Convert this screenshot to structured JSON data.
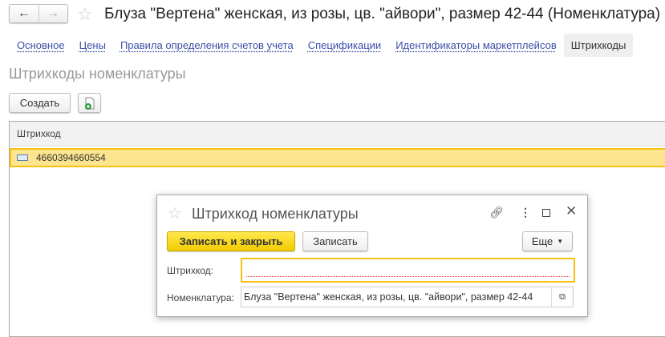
{
  "window": {
    "title": "Блуза \"Вертена\" женская, из розы, цв. \"айвори\", размер 42-44 (Номенклатура)",
    "back": "←",
    "forward": "→"
  },
  "tabs": [
    {
      "label": "Основное"
    },
    {
      "label": "Цены"
    },
    {
      "label": "Правила определения счетов учета"
    },
    {
      "label": "Спецификации"
    },
    {
      "label": "Идентификаторы маркетплейсов"
    },
    {
      "label": "Штрихкоды"
    }
  ],
  "section": {
    "title": "Штрихкоды номенклатуры",
    "create_label": "Создать"
  },
  "grid": {
    "column": "Штрихкод",
    "rows": [
      {
        "barcode": "4660394660554"
      }
    ]
  },
  "dialog": {
    "title": "Штрихкод номенклатуры",
    "save_close": "Записать и закрыть",
    "save": "Записать",
    "more": "Еще",
    "barcode_label": "Штрихкод:",
    "barcode_value": "",
    "item_label": "Номенклатура:",
    "item_value": "Блуза \"Вертена\" женская, из розы, цв. \"айвори\", размер 42-44"
  }
}
